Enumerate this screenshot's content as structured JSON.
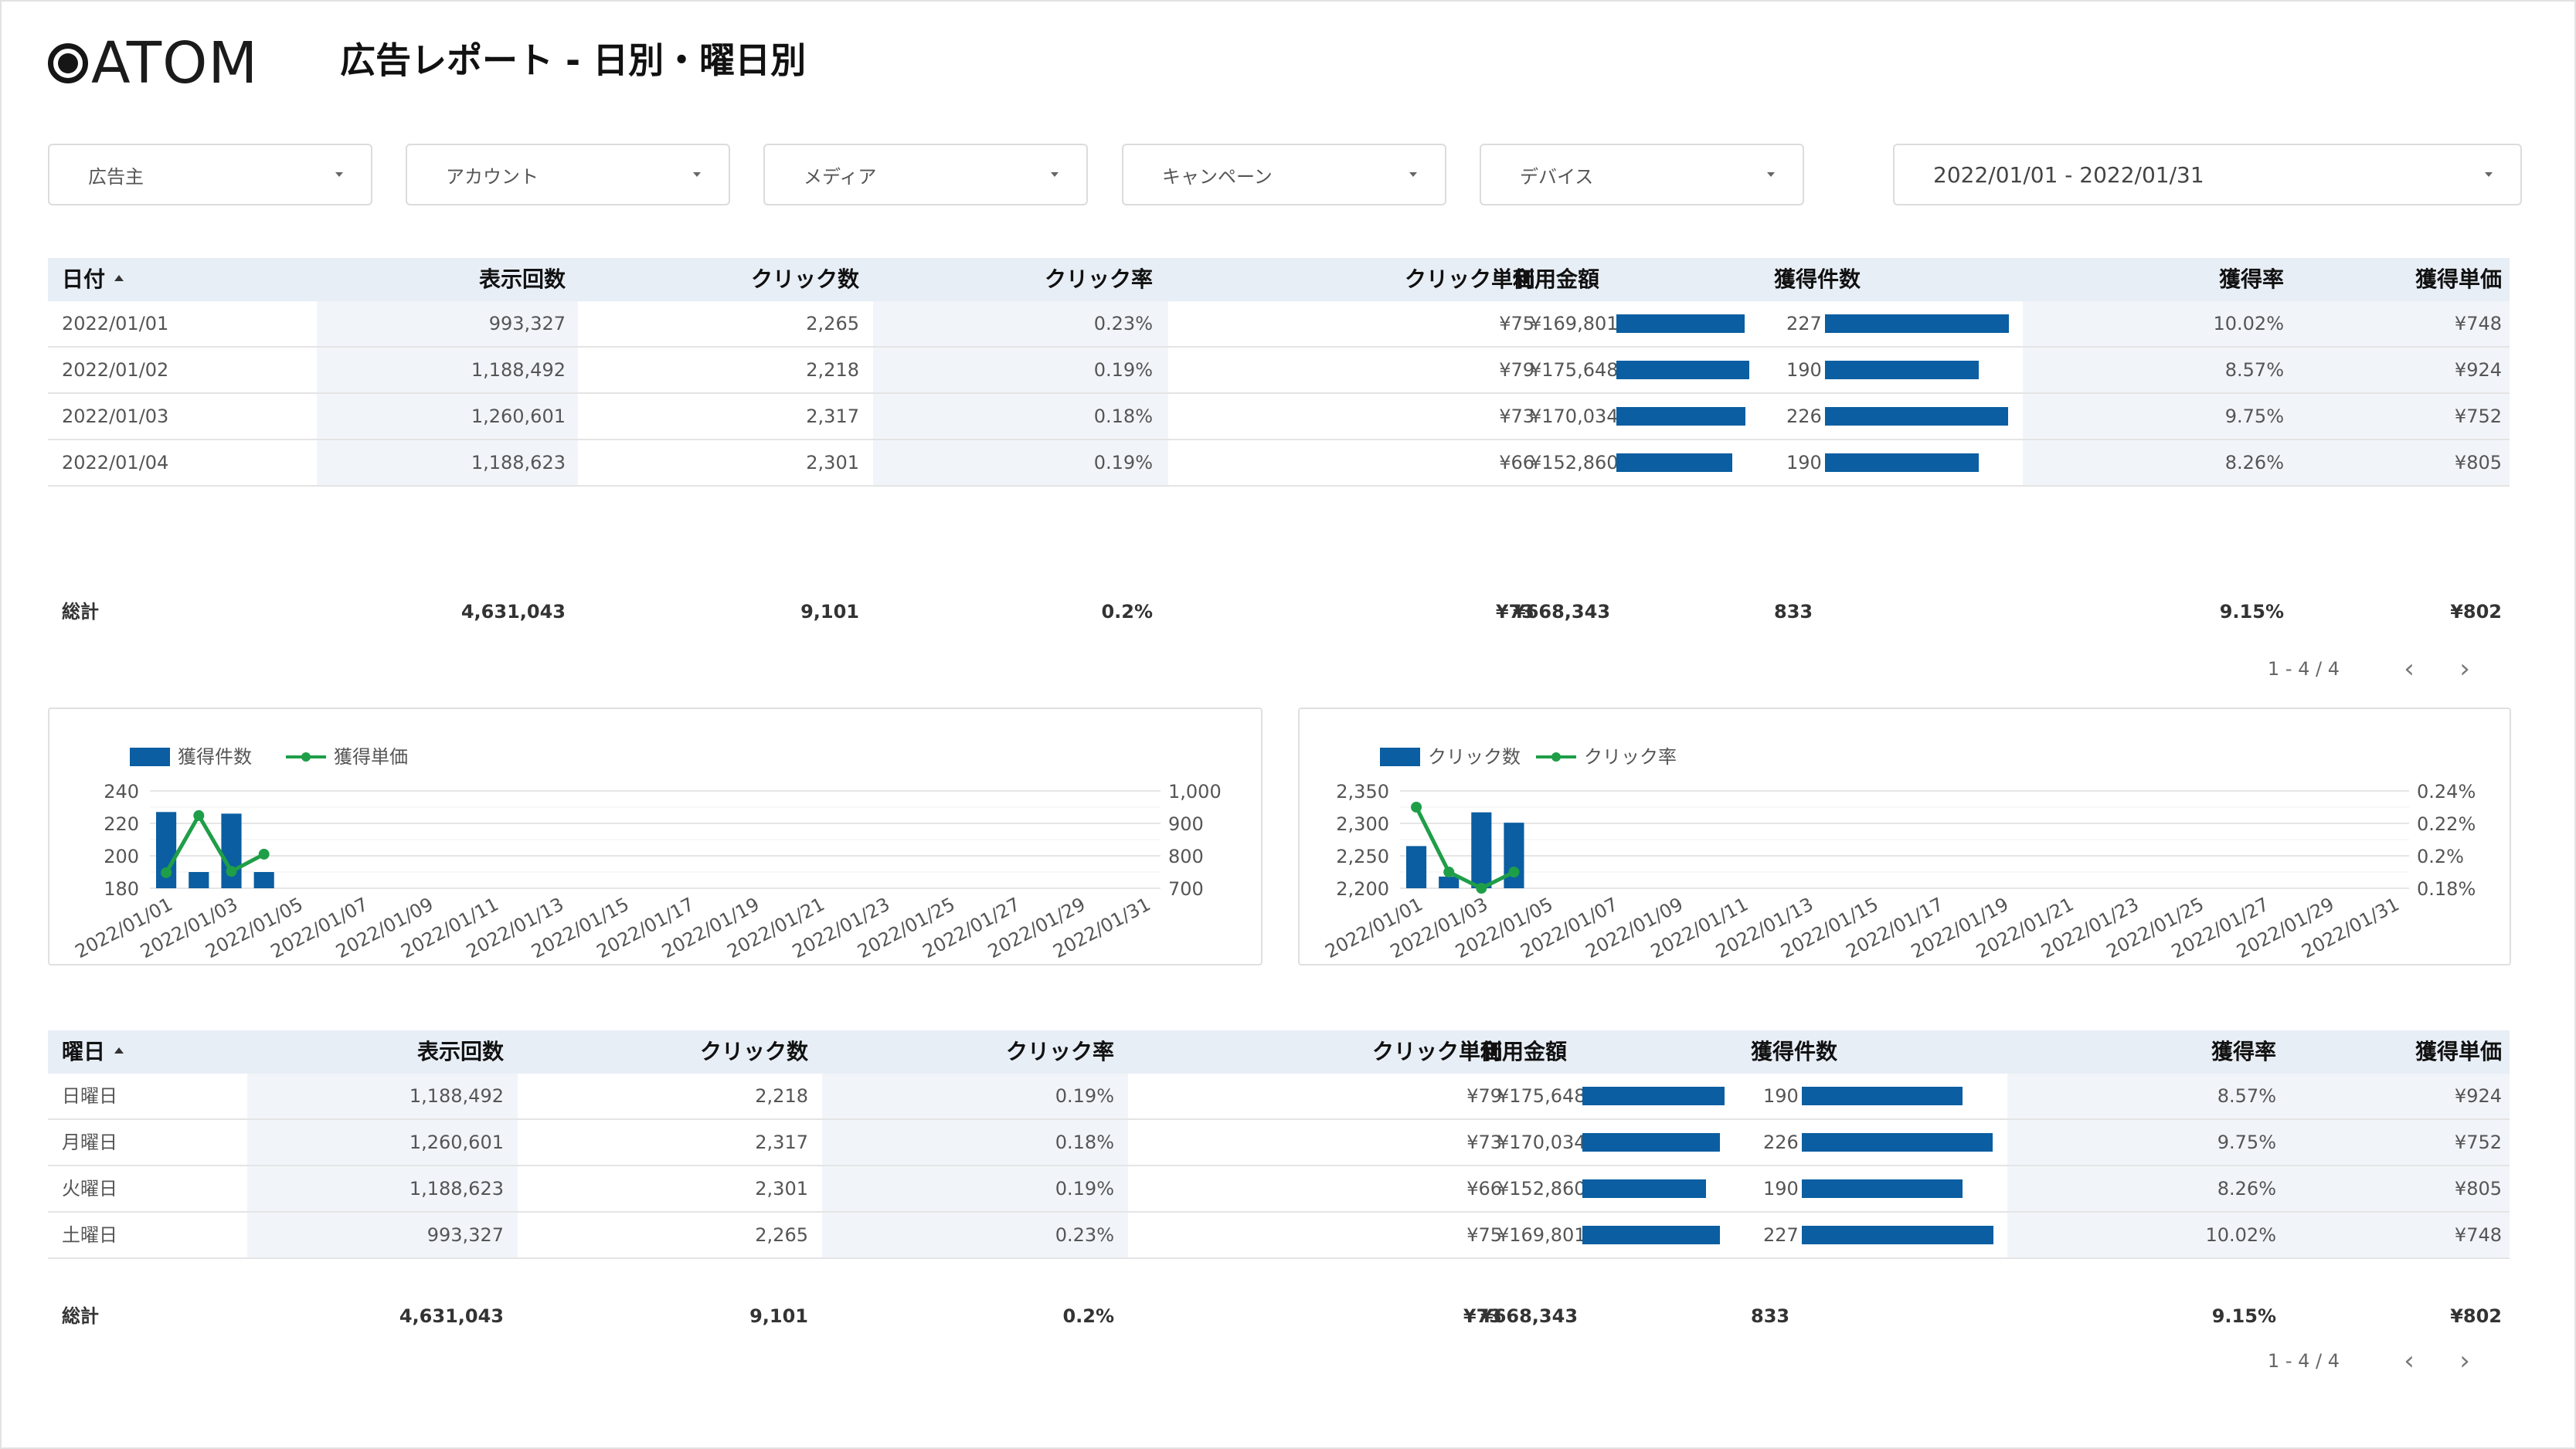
{
  "header": {
    "logo_text": "ATOM",
    "title": "広告レポート - 日別・曜日別"
  },
  "filters": [
    {
      "label": "広告主"
    },
    {
      "label": "アカウント"
    },
    {
      "label": "メディア"
    },
    {
      "label": "キャンペーン"
    },
    {
      "label": "デバイス"
    }
  ],
  "date_range": {
    "label": "2022/01/01 - 2022/01/31"
  },
  "colors": {
    "bar": "#0a5ea1",
    "line": "#1f9e48",
    "header_bg": "#e8eef6",
    "shade": "#f1f5fa"
  },
  "daily_table": {
    "headers": [
      "日付",
      "表示回数",
      "クリック数",
      "クリック率",
      "クリック単価",
      "利用金額",
      "獲得件数",
      "獲得率",
      "獲得単価"
    ],
    "sort_indicator": "ascending",
    "rows": [
      {
        "cells": [
          "2022/01/01",
          "993,327",
          "2,265",
          "0.23%",
          "¥75",
          "¥169,801",
          "227",
          "10.02%",
          "¥748"
        ],
        "spend": 169801,
        "acq": 227
      },
      {
        "cells": [
          "2022/01/02",
          "1,188,492",
          "2,218",
          "0.19%",
          "¥79",
          "¥175,648",
          "190",
          "8.57%",
          "¥924"
        ],
        "spend": 175648,
        "acq": 190
      },
      {
        "cells": [
          "2022/01/03",
          "1,260,601",
          "2,317",
          "0.18%",
          "¥73",
          "¥170,034",
          "226",
          "9.75%",
          "¥752"
        ],
        "spend": 170034,
        "acq": 226
      },
      {
        "cells": [
          "2022/01/04",
          "1,188,623",
          "2,301",
          "0.19%",
          "¥66",
          "¥152,860",
          "190",
          "8.26%",
          "¥805"
        ],
        "spend": 152860,
        "acq": 190
      }
    ],
    "totals": [
      "総計",
      "4,631,043",
      "9,101",
      "0.2%",
      "¥73",
      "¥668,343",
      "833",
      "9.15%",
      "¥802"
    ],
    "pagination": "1 - 4 / 4"
  },
  "weekday_table": {
    "headers": [
      "曜日",
      "表示回数",
      "クリック数",
      "クリック率",
      "クリック単価",
      "利用金額",
      "獲得件数",
      "獲得率",
      "獲得単価"
    ],
    "sort_indicator": "ascending",
    "rows": [
      {
        "cells": [
          "日曜日",
          "1,188,492",
          "2,218",
          "0.19%",
          "¥79",
          "¥175,648",
          "190",
          "8.57%",
          "¥924"
        ],
        "spend": 175648,
        "acq": 190
      },
      {
        "cells": [
          "月曜日",
          "1,260,601",
          "2,317",
          "0.18%",
          "¥73",
          "¥170,034",
          "226",
          "9.75%",
          "¥752"
        ],
        "spend": 170034,
        "acq": 226
      },
      {
        "cells": [
          "火曜日",
          "1,188,623",
          "2,301",
          "0.19%",
          "¥66",
          "¥152,860",
          "190",
          "8.26%",
          "¥805"
        ],
        "spend": 152860,
        "acq": 190
      },
      {
        "cells": [
          "土曜日",
          "993,327",
          "2,265",
          "0.23%",
          "¥75",
          "¥169,801",
          "227",
          "10.02%",
          "¥748"
        ],
        "spend": 169801,
        "acq": 227
      }
    ],
    "totals": [
      "総計",
      "4,631,043",
      "9,101",
      "0.2%",
      "¥73",
      "¥668,343",
      "833",
      "9.15%",
      "¥802"
    ],
    "pagination": "1 - 4 / 4"
  },
  "chart_data": [
    {
      "type": "bar",
      "legend": [
        "獲得件数",
        "獲得単価"
      ],
      "x": [
        "2022/01/01",
        "2022/01/02",
        "2022/01/03",
        "2022/01/04",
        "2022/01/05",
        "2022/01/06",
        "2022/01/07",
        "2022/01/08",
        "2022/01/09",
        "2022/01/10",
        "2022/01/11",
        "2022/01/12",
        "2022/01/13",
        "2022/01/14",
        "2022/01/15",
        "2022/01/16",
        "2022/01/17",
        "2022/01/18",
        "2022/01/19",
        "2022/01/20",
        "2022/01/21",
        "2022/01/22",
        "2022/01/23",
        "2022/01/24",
        "2022/01/25",
        "2022/01/26",
        "2022/01/27",
        "2022/01/28",
        "2022/01/29",
        "2022/01/30",
        "2022/01/31"
      ],
      "x_tick_labels": [
        "2022/01/01",
        "2022/01/03",
        "2022/01/05",
        "2022/01/07",
        "2022/01/09",
        "2022/01/11",
        "2022/01/13",
        "2022/01/15",
        "2022/01/17",
        "2022/01/19",
        "2022/01/21",
        "2022/01/23",
        "2022/01/25",
        "2022/01/27",
        "2022/01/29",
        "2022/01/31"
      ],
      "series": [
        {
          "name": "獲得件数",
          "kind": "bar",
          "axis": "left",
          "values": [
            227,
            190,
            226,
            190
          ]
        },
        {
          "name": "獲得単価",
          "kind": "line",
          "axis": "right",
          "values": [
            748,
            924,
            752,
            805
          ]
        }
      ],
      "y_left": {
        "ticks": [
          "240",
          "220",
          "200",
          "180"
        ],
        "range": [
          180,
          240
        ]
      },
      "y_right": {
        "ticks": [
          "1,000",
          "900",
          "800",
          "700"
        ],
        "range": [
          700,
          1000
        ]
      }
    },
    {
      "type": "bar",
      "legend": [
        "クリック数",
        "クリック率"
      ],
      "x": [
        "2022/01/01",
        "2022/01/02",
        "2022/01/03",
        "2022/01/04",
        "2022/01/05",
        "2022/01/06",
        "2022/01/07",
        "2022/01/08",
        "2022/01/09",
        "2022/01/10",
        "2022/01/11",
        "2022/01/12",
        "2022/01/13",
        "2022/01/14",
        "2022/01/15",
        "2022/01/16",
        "2022/01/17",
        "2022/01/18",
        "2022/01/19",
        "2022/01/20",
        "2022/01/21",
        "2022/01/22",
        "2022/01/23",
        "2022/01/24",
        "2022/01/25",
        "2022/01/26",
        "2022/01/27",
        "2022/01/28",
        "2022/01/29",
        "2022/01/30",
        "2022/01/31"
      ],
      "x_tick_labels": [
        "2022/01/01",
        "2022/01/03",
        "2022/01/05",
        "2022/01/07",
        "2022/01/09",
        "2022/01/11",
        "2022/01/13",
        "2022/01/15",
        "2022/01/17",
        "2022/01/19",
        "2022/01/21",
        "2022/01/23",
        "2022/01/25",
        "2022/01/27",
        "2022/01/29",
        "2022/01/31"
      ],
      "series": [
        {
          "name": "クリック数",
          "kind": "bar",
          "axis": "left",
          "values": [
            2265,
            2218,
            2317,
            2301
          ]
        },
        {
          "name": "クリック率",
          "kind": "line",
          "axis": "right",
          "values": [
            0.23,
            0.19,
            0.18,
            0.19
          ]
        }
      ],
      "y_left": {
        "ticks": [
          "2,350",
          "2,300",
          "2,250",
          "2,200"
        ],
        "range": [
          2200,
          2350
        ]
      },
      "y_right": {
        "ticks": [
          "0.24%",
          "0.22%",
          "0.2%",
          "0.18%"
        ],
        "range": [
          0.18,
          0.24
        ]
      }
    }
  ]
}
